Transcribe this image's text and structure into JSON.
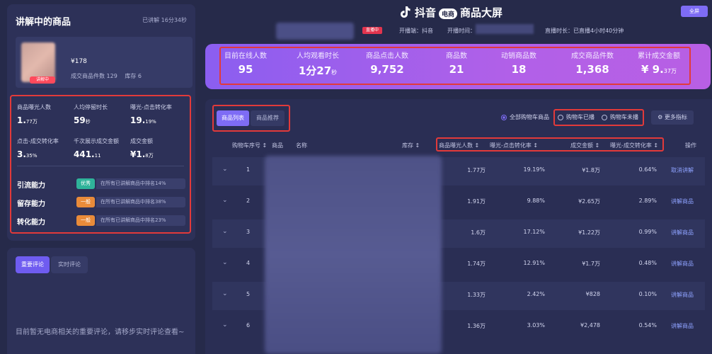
{
  "left_panel": {
    "title": "讲解中的商品",
    "elapsed": "已讲解 16分34秒",
    "product": {
      "price": "¥178",
      "sales_label": "成交商品件数 129",
      "stock_label": "库存 6",
      "tag": "讲解中"
    },
    "metrics": [
      {
        "label": "商品曝光人数",
        "value": "1.",
        "unit": "77万"
      },
      {
        "label": "人均停留时长",
        "value": "59",
        "unit": "秒"
      },
      {
        "label": "曝光-点击转化率",
        "value": "19.",
        "unit": "19%"
      },
      {
        "label": "点击-成交转化率",
        "value": "3.",
        "unit": "35%"
      },
      {
        "label": "千次展示成交金额",
        "value": "441.",
        "unit": "11"
      },
      {
        "label": "成交金额",
        "value": "¥1.",
        "unit": "8万"
      }
    ],
    "abilities": [
      {
        "label": "引流能力",
        "badge": "优秀",
        "badge_color": "#2fb39a",
        "desc": "在所有已讲解商品中排名14%"
      },
      {
        "label": "留存能力",
        "badge": "一般",
        "badge_color": "#e98b3a",
        "desc": "在所有已讲解商品中排名38%"
      },
      {
        "label": "转化能力",
        "badge": "一般",
        "badge_color": "#e98b3a",
        "desc": "在所有已讲解商品中排名23%"
      }
    ]
  },
  "comments": {
    "tab_important": "重要评论",
    "tab_realtime": "实时评论",
    "empty_text": "目前暂无电商相关的重要评论，请移步实时评论查看~"
  },
  "header": {
    "brand": "抖音",
    "brand_pill": "电商",
    "title": "商品大屏",
    "fullscreen": "全屏",
    "live_badge": "直播中",
    "platform": "开播端：抖音",
    "start_time_label": "开播时间：",
    "duration": "直播时长：已直播4小时40分钟"
  },
  "stats": [
    {
      "label": "目前在线人数",
      "value": "95",
      "unit": ""
    },
    {
      "label": "人均观看时长",
      "value": "1分27",
      "unit": "秒"
    },
    {
      "label": "商品点击人数",
      "value": "9,752",
      "unit": ""
    },
    {
      "label": "商品数",
      "value": "21",
      "unit": ""
    },
    {
      "label": "动销商品数",
      "value": "18",
      "unit": ""
    },
    {
      "label": "成交商品件数",
      "value": "1,368",
      "unit": ""
    },
    {
      "label": "累计成交金额",
      "value": "¥ 9.",
      "unit": "37万"
    }
  ],
  "table": {
    "tab_list": "商品列表",
    "tab_recommend": "商品推荐",
    "filter_all": "全部购物车商品",
    "filter_aired": "购物车已播",
    "filter_unaired": "购物车未播",
    "more_metrics": "更多指标",
    "columns": {
      "cart_no": "购物车序号 ↕",
      "product": "商品",
      "name": "名称",
      "stock": "库存 ↕",
      "exposure": "商品曝光人数 ↕",
      "ctr": "曝光-点击转化率 ↕",
      "gmv": "成交金额 ↕",
      "cvr": "曝光-成交转化率 ↕",
      "action": "操作"
    },
    "rows": [
      {
        "no": "1",
        "exposure": "1.77万",
        "ctr": "19.19%",
        "gmv": "¥1.8万",
        "cvr": "0.64%",
        "action": "取消讲解"
      },
      {
        "no": "2",
        "exposure": "1.91万",
        "ctr": "9.88%",
        "gmv": "¥2.65万",
        "cvr": "2.89%",
        "action": "讲解商品"
      },
      {
        "no": "3",
        "exposure": "1.6万",
        "ctr": "17.12%",
        "gmv": "¥1.22万",
        "cvr": "0.99%",
        "action": "讲解商品"
      },
      {
        "no": "4",
        "exposure": "1.74万",
        "ctr": "12.91%",
        "gmv": "¥1.7万",
        "cvr": "0.48%",
        "action": "讲解商品"
      },
      {
        "no": "5",
        "exposure": "1.33万",
        "ctr": "2.42%",
        "gmv": "¥828",
        "cvr": "0.10%",
        "action": "讲解商品"
      },
      {
        "no": "6",
        "exposure": "1.36万",
        "ctr": "3.03%",
        "gmv": "¥2,478",
        "cvr": "0.54%",
        "action": "讲解商品"
      }
    ]
  }
}
